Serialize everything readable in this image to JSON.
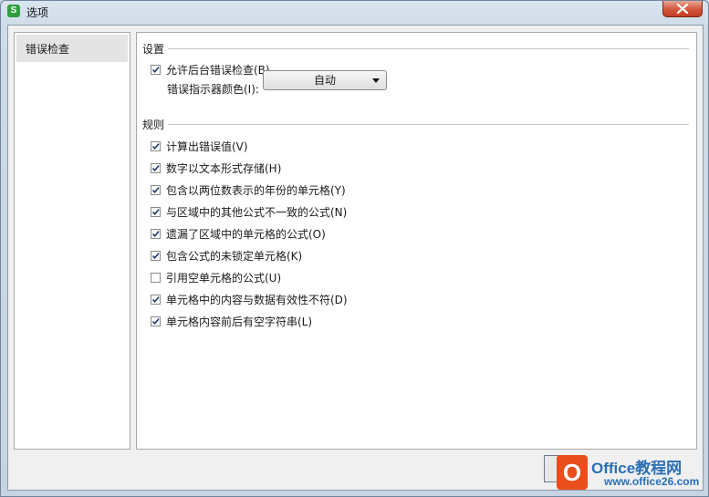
{
  "window": {
    "title": "选项",
    "app_icon_letter": "S"
  },
  "nav": {
    "items": [
      {
        "label": "错误检查"
      }
    ]
  },
  "settings": {
    "heading": "设置",
    "background_check": {
      "label": "允许后台错误检查(B)",
      "checked": true
    },
    "indicator_color": {
      "label": "错误指示器颜色(I):",
      "value": "自动"
    }
  },
  "rules": {
    "heading": "规则",
    "items": [
      {
        "label": "计算出错误值(V)",
        "checked": true
      },
      {
        "label": "数字以文本形式存储(H)",
        "checked": true
      },
      {
        "label": "包含以两位数表示的年份的单元格(Y)",
        "checked": true
      },
      {
        "label": "与区域中的其他公式不一致的公式(N)",
        "checked": true
      },
      {
        "label": "遗漏了区域中的单元格的公式(O)",
        "checked": true
      },
      {
        "label": "包含公式的未锁定单元格(K)",
        "checked": true
      },
      {
        "label": "引用空单元格的公式(U)",
        "checked": false
      },
      {
        "label": "单元格中的内容与数据有效性不符(D)",
        "checked": true
      },
      {
        "label": "单元格内容前后有空字符串(L)",
        "checked": true
      }
    ]
  },
  "watermark": {
    "brand": "Office教程网",
    "site": "www.office26.com",
    "logo_letter": "O"
  }
}
